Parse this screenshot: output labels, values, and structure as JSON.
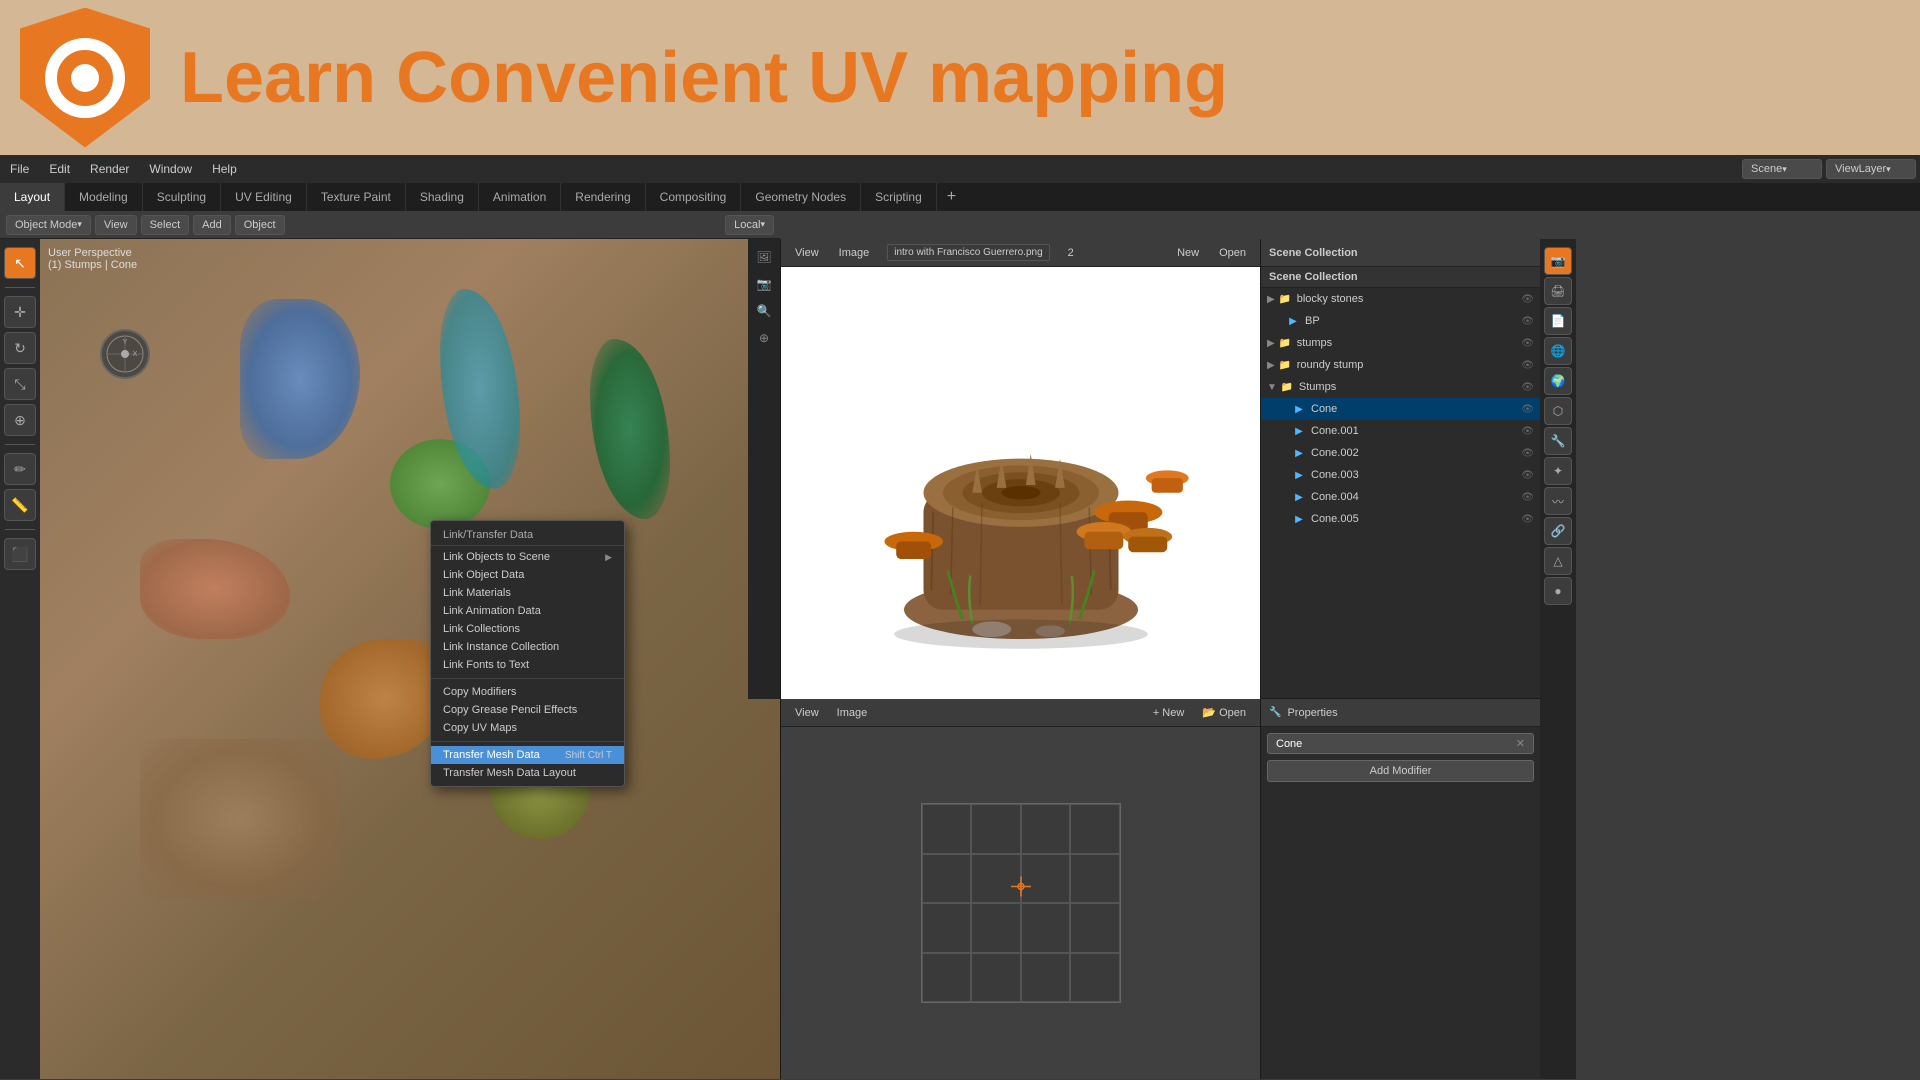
{
  "header": {
    "title": "Learn Convenient UV mapping",
    "logo_alt": "Blender Logo"
  },
  "top_menu": {
    "items": [
      "File",
      "Edit",
      "Render",
      "Window",
      "Help"
    ]
  },
  "workspace_tabs": {
    "tabs": [
      {
        "label": "Layout",
        "active": true
      },
      {
        "label": "Modeling",
        "active": false
      },
      {
        "label": "Sculpting",
        "active": false
      },
      {
        "label": "UV Editing",
        "active": false
      },
      {
        "label": "Texture Paint",
        "active": false
      },
      {
        "label": "Shading",
        "active": false
      },
      {
        "label": "Animation",
        "active": false
      },
      {
        "label": "Rendering",
        "active": false
      },
      {
        "label": "Compositing",
        "active": false
      },
      {
        "label": "Geometry Nodes",
        "active": false
      },
      {
        "label": "Scripting",
        "active": false
      }
    ],
    "add_label": "+"
  },
  "sub_toolbar": {
    "mode_btn": "Object Mode",
    "view_btn": "View",
    "select_btn": "Select",
    "add_btn": "Add",
    "object_btn": "Object",
    "transform_btn": "Local"
  },
  "viewport": {
    "info_line1": "User Perspective",
    "info_line2": "(1) Stumps | Cone"
  },
  "context_menu": {
    "header": "Link/Transfer Data",
    "items": [
      {
        "label": "Link Objects to Scene",
        "has_arrow": true
      },
      {
        "label": "Link Object Data",
        "has_arrow": false
      },
      {
        "label": "Link Materials",
        "has_arrow": false
      },
      {
        "label": "Link Animation Data",
        "has_arrow": false
      },
      {
        "label": "Link Collections",
        "has_arrow": false
      },
      {
        "label": "Link Instance Collection",
        "has_arrow": false
      },
      {
        "label": "Link Fonts to Text",
        "has_arrow": false
      },
      {
        "separator": true
      },
      {
        "label": "Copy Modifiers",
        "has_arrow": false
      },
      {
        "label": "Copy Grease Pencil Effects",
        "has_arrow": false
      },
      {
        "label": "Copy UV Maps",
        "has_arrow": false
      },
      {
        "separator": true
      },
      {
        "label": "Transfer Mesh Data",
        "has_arrow": false,
        "shortcut": "Shift Ctrl T",
        "highlighted": true
      },
      {
        "label": "Transfer Mesh Data Layout",
        "has_arrow": false
      }
    ]
  },
  "image_toolbar": {
    "view_btn": "View",
    "image_btn": "Image",
    "filename": "intro with Francisco Guerrero.png",
    "frame_num": "2",
    "new_btn": "New",
    "open_btn": "Open"
  },
  "outliner": {
    "header": "Scene Collection",
    "items": [
      {
        "label": "blocky stones",
        "indent": 1,
        "icon": "collection",
        "level": 1
      },
      {
        "label": "BP",
        "indent": 2,
        "icon": "mesh",
        "level": 2
      },
      {
        "label": "stumps",
        "indent": 1,
        "icon": "collection",
        "level": 1
      },
      {
        "label": "roundy stump",
        "indent": 1,
        "icon": "collection",
        "level": 1
      },
      {
        "label": "Stumps",
        "indent": 1,
        "icon": "collection",
        "level": 1,
        "expanded": true
      },
      {
        "label": "Cone",
        "indent": 2,
        "icon": "mesh",
        "level": 2,
        "active": true
      },
      {
        "label": "Cone.001",
        "indent": 2,
        "icon": "mesh",
        "level": 2
      },
      {
        "label": "Cone.002",
        "indent": 2,
        "icon": "mesh",
        "level": 2
      },
      {
        "label": "Cone.003",
        "indent": 2,
        "icon": "mesh",
        "level": 2
      },
      {
        "label": "Cone.004",
        "indent": 2,
        "icon": "mesh",
        "level": 2
      },
      {
        "label": "Cone.005",
        "indent": 2,
        "icon": "mesh",
        "level": 2
      }
    ]
  },
  "properties": {
    "object_name": "Cone",
    "add_modifier_btn": "Add Modifier"
  },
  "scene_selector": "Scene",
  "viewlayer_selector": "ViewLayer"
}
